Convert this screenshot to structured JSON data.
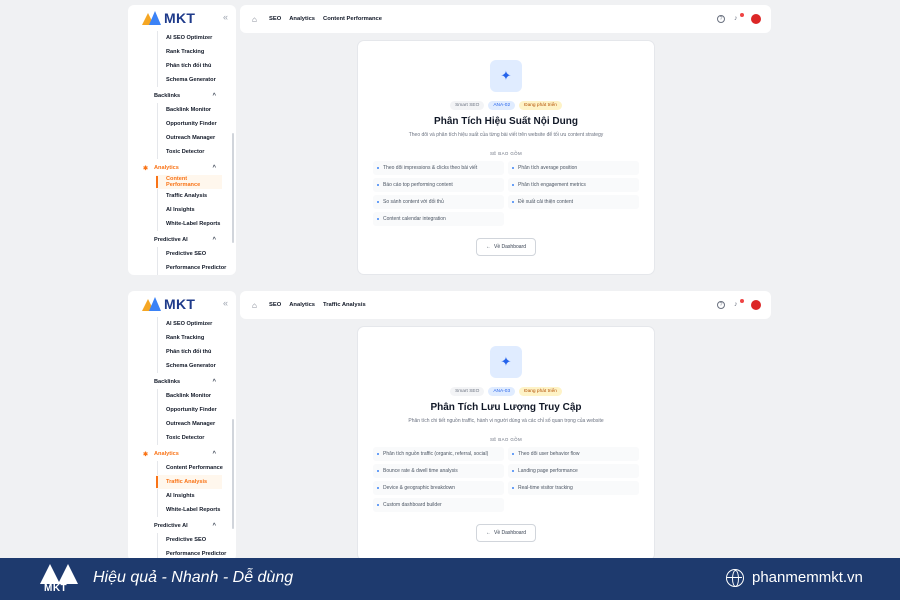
{
  "panels": [
    {
      "logo_text": "MKT",
      "menu": [
        {
          "type": "sub",
          "label": "AI SEO Optimizer"
        },
        {
          "type": "sub",
          "label": "Rank Tracking"
        },
        {
          "type": "sub",
          "label": "Phân tích đối thủ"
        },
        {
          "type": "sub",
          "label": "Schema Generator"
        },
        {
          "type": "group",
          "label": "Backlinks"
        },
        {
          "type": "sub",
          "label": "Backlink Monitor"
        },
        {
          "type": "sub",
          "label": "Opportunity Finder"
        },
        {
          "type": "sub",
          "label": "Outreach Manager"
        },
        {
          "type": "sub",
          "label": "Toxic Detector"
        },
        {
          "type": "group",
          "label": "Analytics",
          "active": true
        },
        {
          "type": "sub",
          "label": "Content Performance",
          "active": true
        },
        {
          "type": "sub",
          "label": "Traffic Analysis"
        },
        {
          "type": "sub",
          "label": "AI Insights"
        },
        {
          "type": "sub",
          "label": "White-Label Reports"
        },
        {
          "type": "group",
          "label": "Predictive AI"
        },
        {
          "type": "sub",
          "label": "Predictive SEO"
        },
        {
          "type": "sub",
          "label": "Performance Predictor"
        }
      ],
      "breadcrumbs": [
        "SEO",
        "Analytics",
        "Content Performance"
      ],
      "card": {
        "tags": [
          "Smart SEO",
          "ANA-02",
          "Đang phát triển"
        ],
        "title": "Phân Tích Hiệu Suất Nội Dung",
        "description": "Theo dõi và phân tích hiệu suất của từng bài viết trên website để tối ưu content strategy",
        "section_label": "SẼ BAO GỒM",
        "features": [
          "Theo dõi impressions & clicks theo bài viết",
          "Phân tích average position",
          "Báo cáo top performing content",
          "Phân tích engagement metrics",
          "So sánh content với đối thủ",
          "Đề xuất cải thiện content",
          "Content calendar integration"
        ],
        "back_label": "Về Dashboard"
      }
    },
    {
      "logo_text": "MKT",
      "menu": [
        {
          "type": "sub",
          "label": "AI SEO Optimizer"
        },
        {
          "type": "sub",
          "label": "Rank Tracking"
        },
        {
          "type": "sub",
          "label": "Phân tích đối thủ"
        },
        {
          "type": "sub",
          "label": "Schema Generator"
        },
        {
          "type": "group",
          "label": "Backlinks"
        },
        {
          "type": "sub",
          "label": "Backlink Monitor"
        },
        {
          "type": "sub",
          "label": "Opportunity Finder"
        },
        {
          "type": "sub",
          "label": "Outreach Manager"
        },
        {
          "type": "sub",
          "label": "Toxic Detector"
        },
        {
          "type": "group",
          "label": "Analytics",
          "active": true
        },
        {
          "type": "sub",
          "label": "Content Performance"
        },
        {
          "type": "sub",
          "label": "Traffic Analysis",
          "active": true
        },
        {
          "type": "sub",
          "label": "AI Insights"
        },
        {
          "type": "sub",
          "label": "White-Label Reports"
        },
        {
          "type": "group",
          "label": "Predictive AI"
        },
        {
          "type": "sub",
          "label": "Predictive SEO"
        },
        {
          "type": "sub",
          "label": "Performance Predictor"
        }
      ],
      "breadcrumbs": [
        "SEO",
        "Analytics",
        "Traffic Analysis"
      ],
      "card": {
        "tags": [
          "Smart SEO",
          "ANA-03",
          "Đang phát triển"
        ],
        "title": "Phân Tích Lưu Lượng Truy Cập",
        "description": "Phân tích chi tiết nguồn traffic, hành vi người dùng và các chỉ số quan trọng của website",
        "section_label": "SẼ BAO GỒM",
        "features": [
          "Phân tích nguồn traffic (organic, referral, social)",
          "Theo dõi user behavior flow",
          "Bounce rate & dwell time analysis",
          "Landing page performance",
          "Device & geographic breakdown",
          "Real-time visitor tracking",
          "Custom dashboard builder"
        ],
        "back_label": "Về Dashboard"
      }
    }
  ],
  "footer": {
    "logo_text": "MKT",
    "tagline": "Hiệu quả - Nhanh - Dễ dùng",
    "website": "phanmemmkt.vn"
  },
  "colors": {
    "accent": "#f97316",
    "brand_blue": "#1e3a6e",
    "primary": "#2563eb"
  }
}
